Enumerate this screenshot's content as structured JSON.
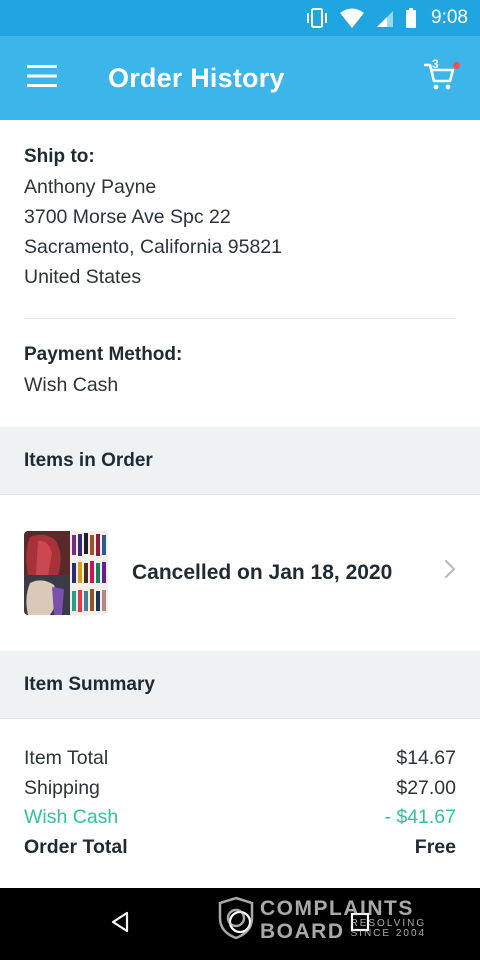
{
  "status_bar": {
    "time": "9:08",
    "icons": [
      "vibrate-icon",
      "wifi-icon",
      "signal-icon",
      "battery-icon"
    ]
  },
  "app_bar": {
    "title": "Order History",
    "menu_icon": "hamburger-menu-icon",
    "cart_icon": "shopping-cart-icon",
    "cart_count": "3",
    "accent_color": "#3cb6ea",
    "notification_dot_color": "#ff4b4b"
  },
  "shipping": {
    "label": "Ship to:",
    "name": "Anthony Payne",
    "street": "3700 Morse Ave Spc 22",
    "city_state_zip": "Sacramento, California 95821",
    "country": "United States"
  },
  "payment": {
    "label": "Payment Method:",
    "method": "Wish Cash"
  },
  "items_section": {
    "title": "Items in Order",
    "items": [
      {
        "image": "hair-extensions-product-thumbnail",
        "status": "Cancelled on Jan 18, 2020"
      }
    ]
  },
  "summary": {
    "title": "Item Summary",
    "item_total_label": "Item Total",
    "item_total_value": "$14.67",
    "shipping_label": "Shipping",
    "shipping_value": "$27.00",
    "wish_cash_label": "Wish Cash",
    "wish_cash_value": "- $41.67",
    "order_total_label": "Order Total",
    "order_total_value": "Free",
    "credit_color": "#2fc49a"
  },
  "nav_bar": {
    "buttons": [
      "back-icon",
      "home-icon",
      "recents-icon"
    ]
  },
  "watermark": {
    "line1": "COMPLAINTS",
    "line2": "BOARD",
    "tagline1": "RESOLVING",
    "tagline2": "SINCE 2004"
  }
}
